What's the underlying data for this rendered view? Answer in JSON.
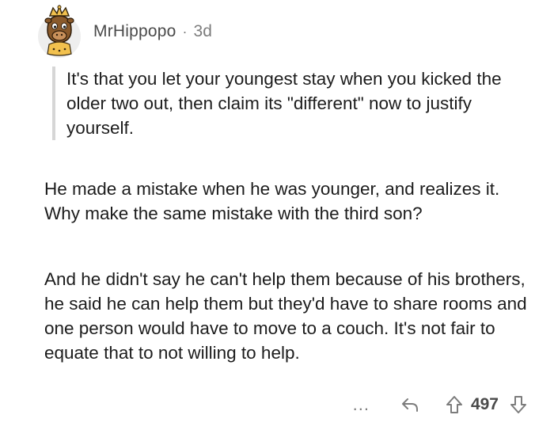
{
  "comment": {
    "author": "MrHippopo",
    "separator": "·",
    "age": "3d",
    "quote": "It's that you let your youngest stay when you kicked the older two out, then claim its \"different\" now to justify yourself.",
    "paragraphs": [
      "He made a mistake when he was younger, and realizes it. Why make the same mistake with the third son?",
      "And he didn't say he can't help them because of his brothers, he said he can help them but they'd have to share rooms and one person would have to move to a couch. It's not fair to equate that to not willing to help."
    ],
    "actions": {
      "more": "...",
      "score": "497"
    }
  },
  "icons": {
    "avatar": "avatar",
    "reply": "reply-icon",
    "upvote": "upvote-icon",
    "downvote": "downvote-icon"
  },
  "colors": {
    "text": "#1c1c1c",
    "meta": "#7c7c7c",
    "quote_bar": "#d6d6d6"
  }
}
